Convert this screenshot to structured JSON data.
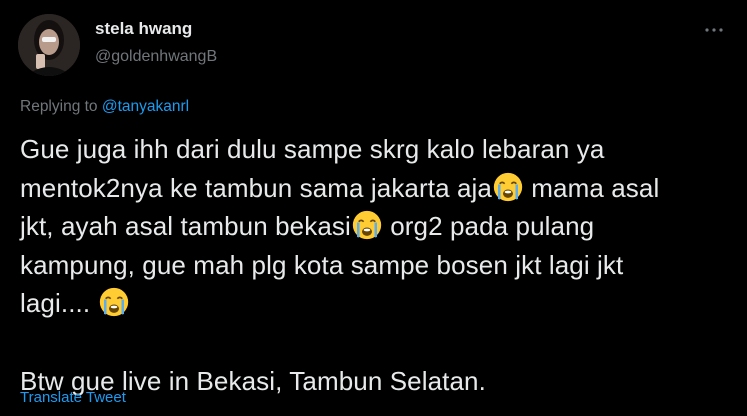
{
  "author": {
    "name": "stela hwang",
    "handle": "@goldenhwangB"
  },
  "more_icon": "more-horizontal-icon",
  "reply": {
    "prefix": "Replying to",
    "mention": "@tanyakanrl"
  },
  "tweet": {
    "line1": "Gue juga ihh dari dulu sampe skrg kalo lebaran ya",
    "line2_a": "mentok2nya ke tambun sama jakarta aja",
    "line2_b": " mama asal",
    "line3_a": "jkt, ayah asal tambun bekasi",
    "line3_b": " org2 pada pulang",
    "line4": "kampung, gue mah plg kota sampe bosen jkt lagi jkt",
    "line5": "lagi.... ",
    "line7": "Btw gue live in Bekasi, Tambun Selatan.",
    "emoji": "loudly-crying-face-icon"
  },
  "translate_label": "Translate Tweet",
  "colors": {
    "background": "#000000",
    "text": "#e7e9ea",
    "secondary": "#71767b",
    "link": "#1d9bf0",
    "emoji_face": "#ffcc33",
    "emoji_tears": "#5dadec"
  }
}
